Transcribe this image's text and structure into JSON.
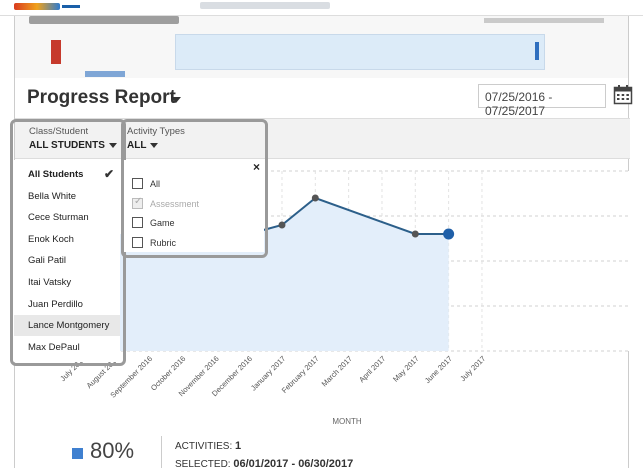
{
  "header": {
    "title": "Progress Report",
    "date_range": "07/25/2016 - 07/25/2017"
  },
  "filters": {
    "class_label": "Class/Student",
    "class_value": "ALL STUDENTS",
    "activity_label": "Activity Types",
    "activity_value": "ALL"
  },
  "students_dropdown": {
    "selected": "All Students",
    "items": [
      "All Students",
      "Bella White",
      "Cece Sturman",
      "Enok Koch",
      "Gali Patil",
      "Itai Vatsky",
      "Juan Perdillo",
      "Lance Montgomery",
      "Max DePaul"
    ],
    "hovered": "Lance Montgomery"
  },
  "activity_dropdown": {
    "close": "×",
    "items": [
      {
        "label": "All",
        "checked": false,
        "disabled": false
      },
      {
        "label": "Assessment",
        "checked": true,
        "disabled": true
      },
      {
        "label": "Game",
        "checked": false,
        "disabled": false
      },
      {
        "label": "Rubric",
        "checked": false,
        "disabled": false
      }
    ]
  },
  "chart_data": {
    "type": "line",
    "xlabel": "MONTH",
    "categories": [
      "July 2016",
      "August 2016",
      "September 2016",
      "October 2016",
      "November 2016",
      "December 2016",
      "January 2017",
      "February 2017",
      "March 2017",
      "April 2017",
      "May 2017",
      "June 2017",
      "July 2017"
    ],
    "series": [
      {
        "values": [
          null,
          null,
          null,
          null,
          null,
          65,
          70,
          85,
          null,
          null,
          65,
          65,
          null
        ]
      }
    ],
    "ylim": [
      0,
      100
    ],
    "grid": true,
    "colors": {
      "line": "#2c5f8a",
      "fill": "#e3eefa",
      "point": "#555555",
      "last_point": "#1f5fa8"
    }
  },
  "summary": {
    "percent": "80%",
    "activities_label": "ACTIVITIES:",
    "activities_value": "1",
    "selected_label": "SELECTED:",
    "selected_value": "06/01/2017 - 06/30/2017",
    "swatch_color": "#3f80d0"
  }
}
